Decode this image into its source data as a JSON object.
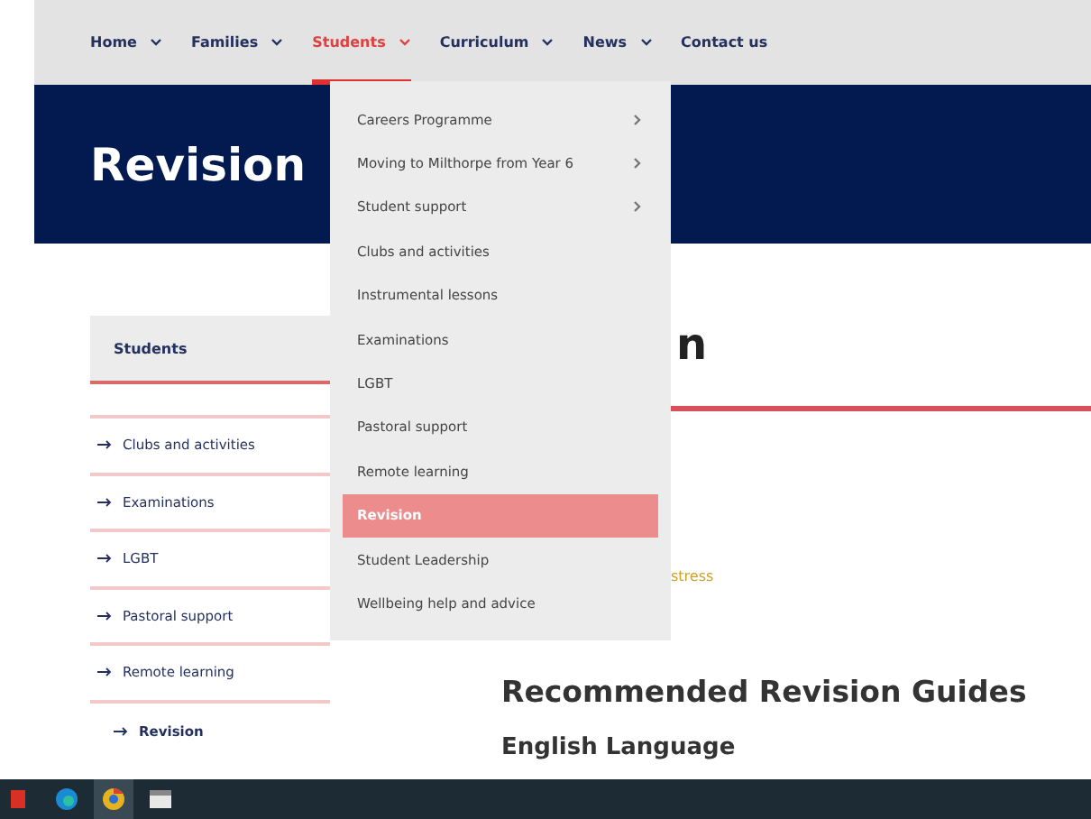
{
  "nav": {
    "items": [
      {
        "label": "Home",
        "selected": false,
        "has_dropdown": true
      },
      {
        "label": "Families",
        "selected": false,
        "has_dropdown": true
      },
      {
        "label": "Students",
        "selected": true,
        "has_dropdown": true
      },
      {
        "label": "Curriculum",
        "selected": false,
        "has_dropdown": true
      },
      {
        "label": "News",
        "selected": false,
        "has_dropdown": true
      },
      {
        "label": "Contact us",
        "selected": false,
        "has_dropdown": false
      }
    ]
  },
  "banner": {
    "title": "Revision"
  },
  "dropdown": {
    "items": [
      {
        "label": "Careers Programme",
        "has_submenu": true,
        "selected": false
      },
      {
        "label": "Moving to Milthorpe from Year 6",
        "has_submenu": true,
        "selected": false
      },
      {
        "label": "Student support",
        "has_submenu": true,
        "selected": false
      },
      {
        "label": "Clubs and activities",
        "has_submenu": false,
        "selected": false
      },
      {
        "label": "Instrumental lessons",
        "has_submenu": false,
        "selected": false
      },
      {
        "label": "Examinations",
        "has_submenu": false,
        "selected": false
      },
      {
        "label": "LGBT",
        "has_submenu": false,
        "selected": false
      },
      {
        "label": "Pastoral support",
        "has_submenu": false,
        "selected": false
      },
      {
        "label": "Remote learning",
        "has_submenu": false,
        "selected": false
      },
      {
        "label": "Revision",
        "has_submenu": false,
        "selected": true
      },
      {
        "label": "Student Leadership",
        "has_submenu": false,
        "selected": false
      },
      {
        "label": "Wellbeing help and advice",
        "has_submenu": false,
        "selected": false
      }
    ]
  },
  "sidebar": {
    "title": "Students",
    "items": [
      {
        "label": "Clubs and activities",
        "selected": false
      },
      {
        "label": "Examinations",
        "selected": false
      },
      {
        "label": "LGBT",
        "selected": false
      },
      {
        "label": "Pastoral support",
        "selected": false
      },
      {
        "label": "Remote learning",
        "selected": false
      },
      {
        "label": "Revision",
        "selected": true
      }
    ]
  },
  "main": {
    "heading_fragment": "n",
    "link_fragment": "stress",
    "section_heading": "Recommended Revision Guides",
    "subheading": "English Language"
  },
  "taskbar": {
    "apps": [
      {
        "kind": "red-app",
        "selected": false
      },
      {
        "kind": "browser-blue",
        "selected": false
      },
      {
        "kind": "browser-round",
        "selected": true
      },
      {
        "kind": "window",
        "selected": false
      }
    ]
  }
}
